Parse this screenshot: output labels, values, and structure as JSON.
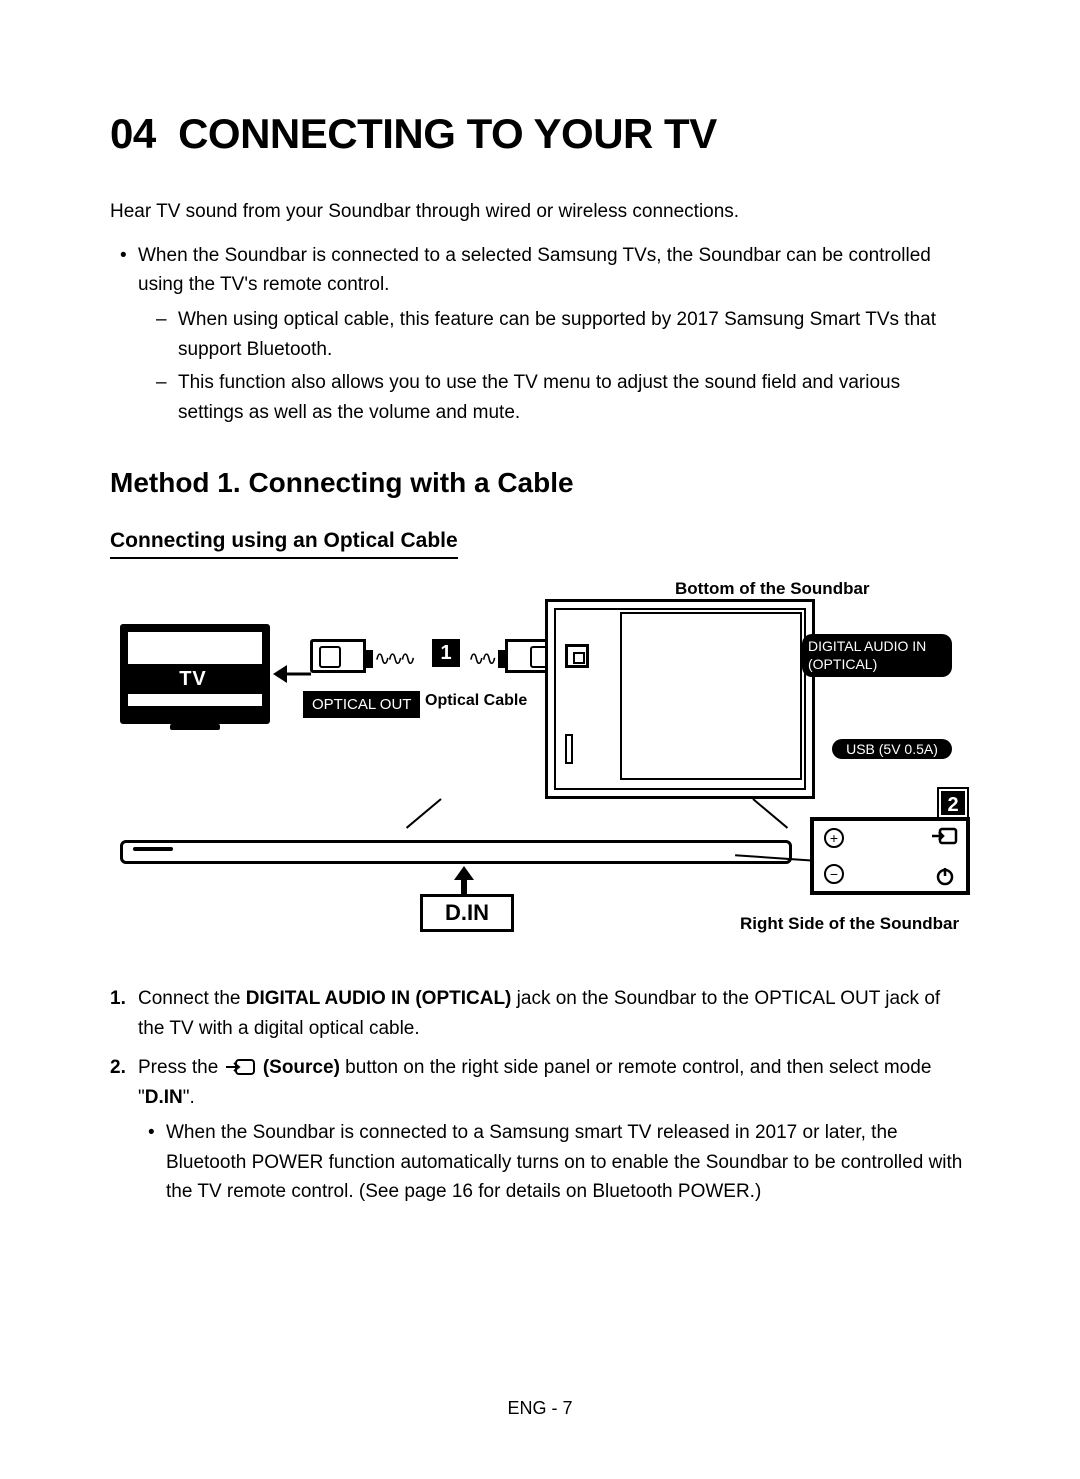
{
  "chapter": {
    "number": "04",
    "title": "CONNECTING TO YOUR TV"
  },
  "intro": "Hear TV sound from your Soundbar through wired or wireless connections.",
  "bullets": [
    {
      "text": "When the Soundbar is connected to a selected Samsung TVs, the Soundbar can be controlled using the TV's remote control.",
      "sub": [
        "When using optical cable, this feature can be supported by 2017 Samsung Smart TVs that support Bluetooth.",
        "This function also allows you to use the TV menu to adjust the sound field and various settings as well as the volume and mute."
      ]
    }
  ],
  "section": "Method 1. Connecting with a Cable",
  "subsection": "Connecting using an Optical Cable",
  "diagram": {
    "bottom_label": "Bottom of the Soundbar",
    "right_label": "Right Side of the Soundbar",
    "tv_label": "TV",
    "optical_out": "OPTICAL OUT",
    "optical_cable": "Optical Cable",
    "digital_in": "DIGITAL AUDIO IN (OPTICAL)",
    "usb": "USB (5V 0.5A)",
    "din": "D.IN",
    "num1": "1",
    "num2": "2"
  },
  "steps": [
    {
      "pre": "Connect the ",
      "bold": "DIGITAL AUDIO IN (OPTICAL)",
      "post": " jack on the Soundbar to the OPTICAL OUT jack of the TV with a digital optical cable."
    },
    {
      "pre": "Press the ",
      "bold": "(Source)",
      "mid": " button on the right side panel or remote control, and then select mode \"",
      "bold2": "D.IN",
      "post": "\".",
      "sub": [
        "When the Soundbar is connected to a Samsung smart TV released in 2017 or later, the Bluetooth POWER function automatically turns on to enable the Soundbar to be controlled with the TV remote control. (See page 16 for details on Bluetooth POWER.)"
      ]
    }
  ],
  "footer": "ENG - 7"
}
